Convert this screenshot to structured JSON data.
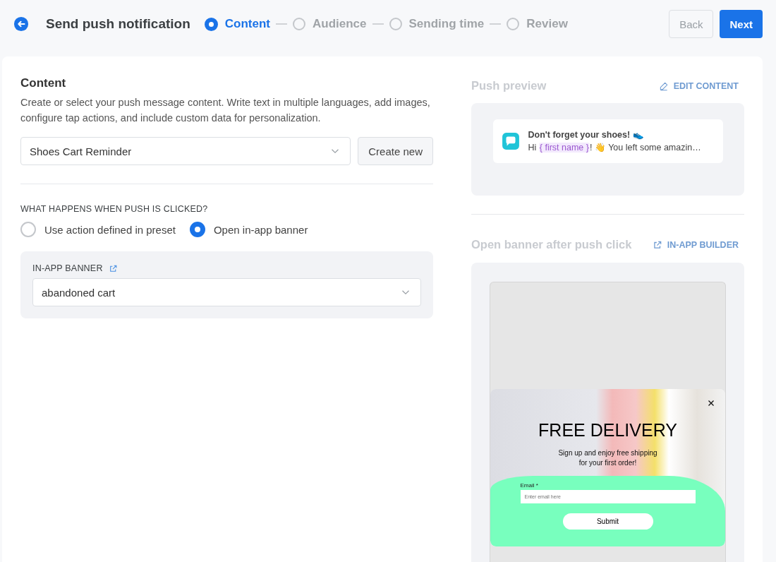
{
  "header": {
    "title": "Send push notification",
    "steps": [
      {
        "label": "Content",
        "selected": true
      },
      {
        "label": "Audience",
        "selected": false
      },
      {
        "label": "Sending time",
        "selected": false
      },
      {
        "label": "Review",
        "selected": false
      }
    ],
    "buttons": [
      {
        "label": "Back",
        "kind": "secondary"
      },
      {
        "label": "Next",
        "kind": "primary"
      }
    ]
  },
  "content": {
    "title": "Content",
    "description": "Create or select your push message content. Write text in multiple languages, add images, configure tap actions, and include custom data for personalization.",
    "preset": {
      "value": "Shoes Cart Reminder"
    },
    "create_button": "Create new",
    "click_action": {
      "label": "WHAT HAPPENS WHEN PUSH IS CLICKED?",
      "options": [
        {
          "label": "Use action defined in preset",
          "selected": false
        },
        {
          "label": "Open in-app banner",
          "selected": true
        }
      ]
    },
    "banner_select": {
      "label": "IN-APP BANNER",
      "value": "abandoned cart"
    }
  },
  "preview": {
    "title": "Push preview",
    "edit_link": "EDIT CONTENT",
    "notification": {
      "title": "Don't forget your shoes! 👟",
      "body_prefix": "Hi ",
      "token": "{ first name }",
      "body_suffix": "! 👋 You left some amazin…"
    },
    "banner_title": "Open banner after push click",
    "builder_link": "IN-APP BUILDER",
    "banner": {
      "heading": "FREE DELIVERY",
      "text": "Sign up and enjoy free shipping\nfor your first order!",
      "email_label": "Email *",
      "email_placeholder": "Enter email here",
      "submit": "Submit"
    }
  }
}
